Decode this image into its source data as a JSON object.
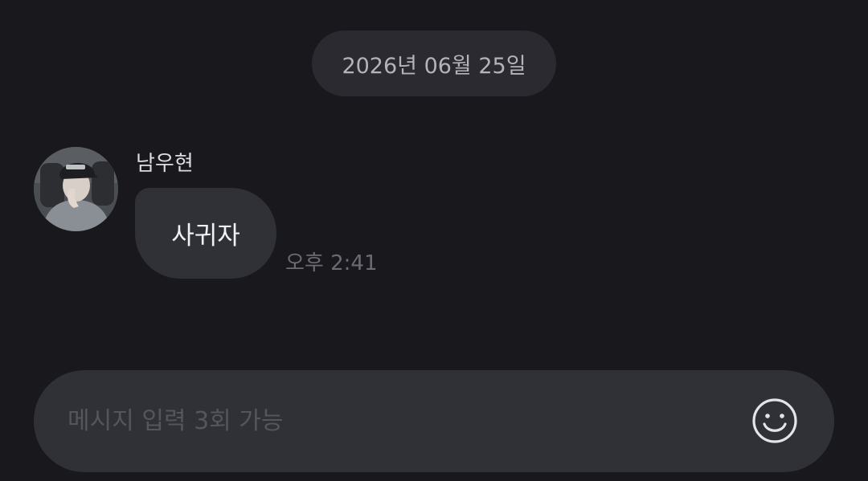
{
  "chat": {
    "date_label": "2026년 06월 25일",
    "messages": [
      {
        "sender": "남우현",
        "text": "사귀자",
        "time": "오후 2:41"
      }
    ]
  },
  "composer": {
    "placeholder": "메시지 입력 3회 가능",
    "emoji_icon": "smiley-icon"
  },
  "colors": {
    "background": "#18181d",
    "bubble": "#303137",
    "date_pill": "#2a2a30",
    "composer": "#303137"
  }
}
